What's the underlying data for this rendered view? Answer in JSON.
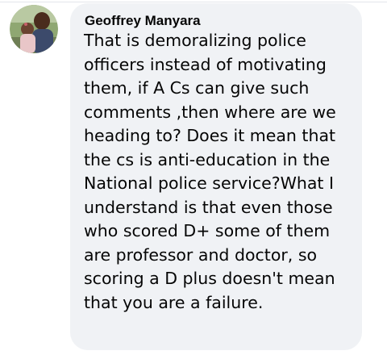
{
  "comment": {
    "author": "Geoffrey Manyara",
    "text": "That is demoralizing police\nofficers instead of motivating\nthem, if A Cs can give such\ncomments ,then where are we\nheading to? Does it mean that\nthe cs is anti-education in the\nNational police service?What I\nunderstand is that even those\nwho scored D+ some of them\nare professor and doctor, so\nscoring a D plus doesn't mean\nthat you are a failure."
  },
  "colors": {
    "bubble": "#f0f2f5",
    "text": "#050505",
    "page": "#ffffff"
  }
}
